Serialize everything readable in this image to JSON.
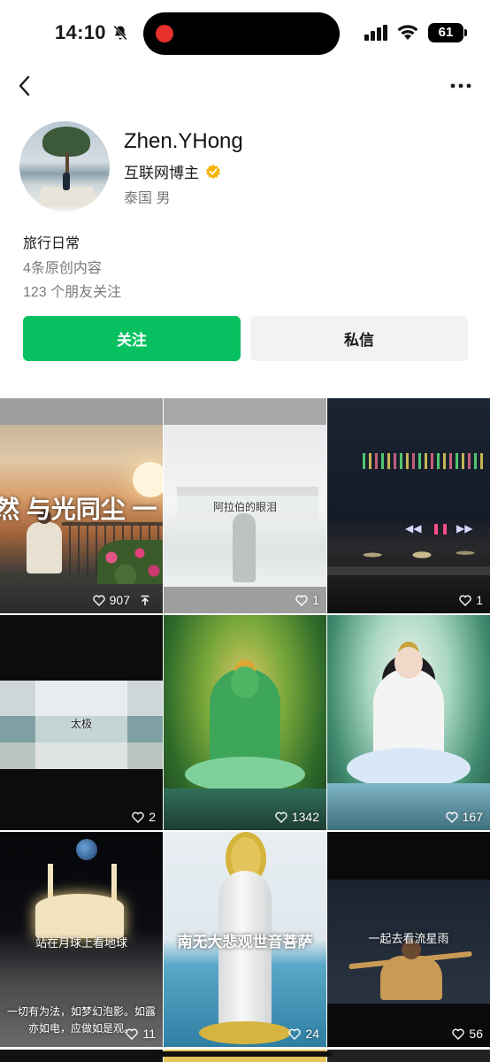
{
  "status_bar": {
    "time": "14:10",
    "battery": "61"
  },
  "profile": {
    "name": "Zhen.YHong",
    "title": "互联网博主",
    "location": "泰国 男",
    "bio": "旅行日常",
    "original_count": "4条原创内容",
    "friends_following": "123 个朋友关注"
  },
  "actions": {
    "follow_label": "关注",
    "message_label": "私信"
  },
  "grid": {
    "tiles": [
      {
        "caption": "然 与光同尘 一",
        "likes": "907",
        "pinned": true
      },
      {
        "caption": "阿拉伯的眼泪",
        "likes": "1"
      },
      {
        "caption": "",
        "likes": "1"
      },
      {
        "caption": "太极",
        "likes": "2"
      },
      {
        "caption": "",
        "likes": "1342"
      },
      {
        "caption": "",
        "likes": "167"
      },
      {
        "caption": "站在月球上看地球",
        "caption_bottom": "一切有为法，如梦幻泡影。如露亦如电，应做如是观。",
        "likes": "11"
      },
      {
        "caption": "南无大悲观世音菩萨",
        "likes": "24"
      },
      {
        "caption": "一起去看流星雨",
        "likes": "56"
      }
    ]
  },
  "colors": {
    "accent_green": "#07c160",
    "verified_badge": "#f5b400",
    "secondary_text": "#7a7a7a",
    "button_gray": "#f2f2f2"
  },
  "icons": [
    "bell-off-icon",
    "signal-icon",
    "wifi-icon",
    "back-chevron-icon",
    "more-icon",
    "verified-badge-icon",
    "heart-icon",
    "pin-icon"
  ]
}
